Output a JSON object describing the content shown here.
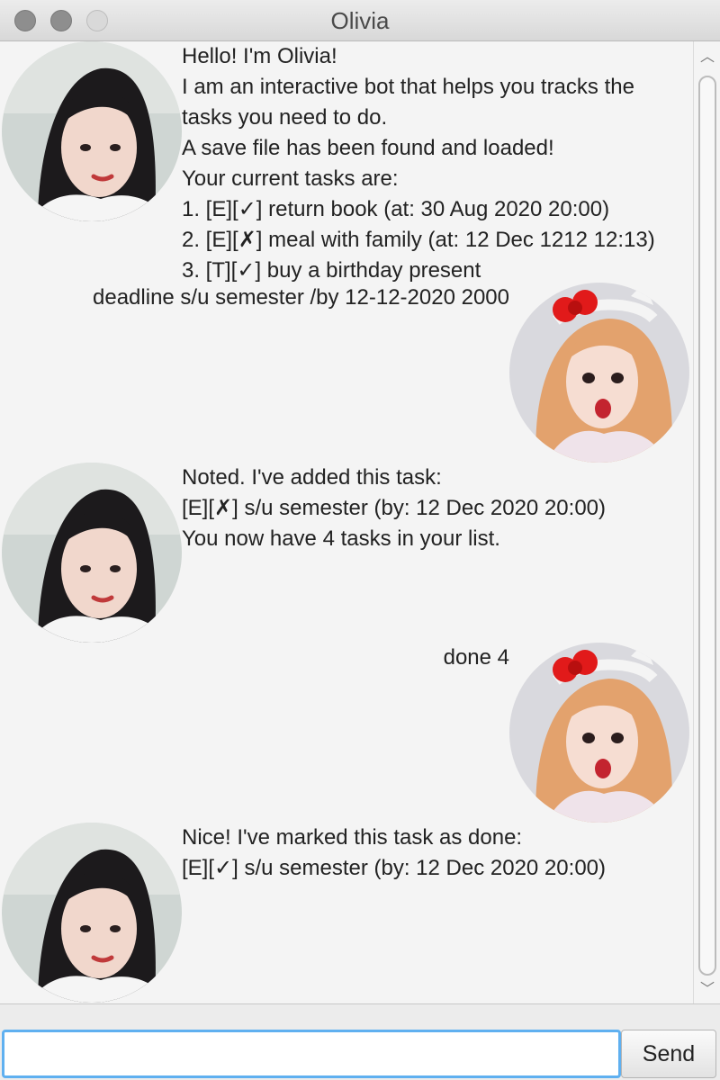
{
  "window": {
    "title": "Olivia"
  },
  "chat": {
    "messages": [
      {
        "sender": "bot",
        "lines": [
          "Hello! I'm Olivia!",
          "I am an interactive bot that helps you tracks the",
          "tasks you need to do.",
          "A save file has been found and loaded!",
          "Your current tasks are:",
          "1. [E][✓] return book (at: 30 Aug 2020 20:00)",
          "2. [E][✗] meal with family (at: 12 Dec 1212 12:13)",
          "3. [T][✓] buy a birthday present"
        ]
      },
      {
        "sender": "user",
        "lines": [
          "deadline s/u semester /by 12-12-2020 2000"
        ]
      },
      {
        "sender": "bot",
        "lines": [
          "Noted. I've added this task:",
          "[E][✗] s/u semester (by: 12 Dec 2020 20:00)",
          "You now have 4 tasks in your list."
        ]
      },
      {
        "sender": "user",
        "lines": [
          "done 4"
        ]
      },
      {
        "sender": "bot",
        "lines": [
          "Nice! I've marked this task as done:",
          "[E][✓] s/u semester (by: 12 Dec 2020 20:00)"
        ]
      }
    ]
  },
  "input": {
    "value": "",
    "placeholder": ""
  },
  "send_button": {
    "label": "Send"
  },
  "colors": {
    "chat_background": "#f4f4f4",
    "input_focus_border": "#5fb0f0",
    "text": "#222222"
  },
  "icons": {
    "scroll_up": "chevron-up-icon",
    "scroll_down": "chevron-down-icon"
  }
}
